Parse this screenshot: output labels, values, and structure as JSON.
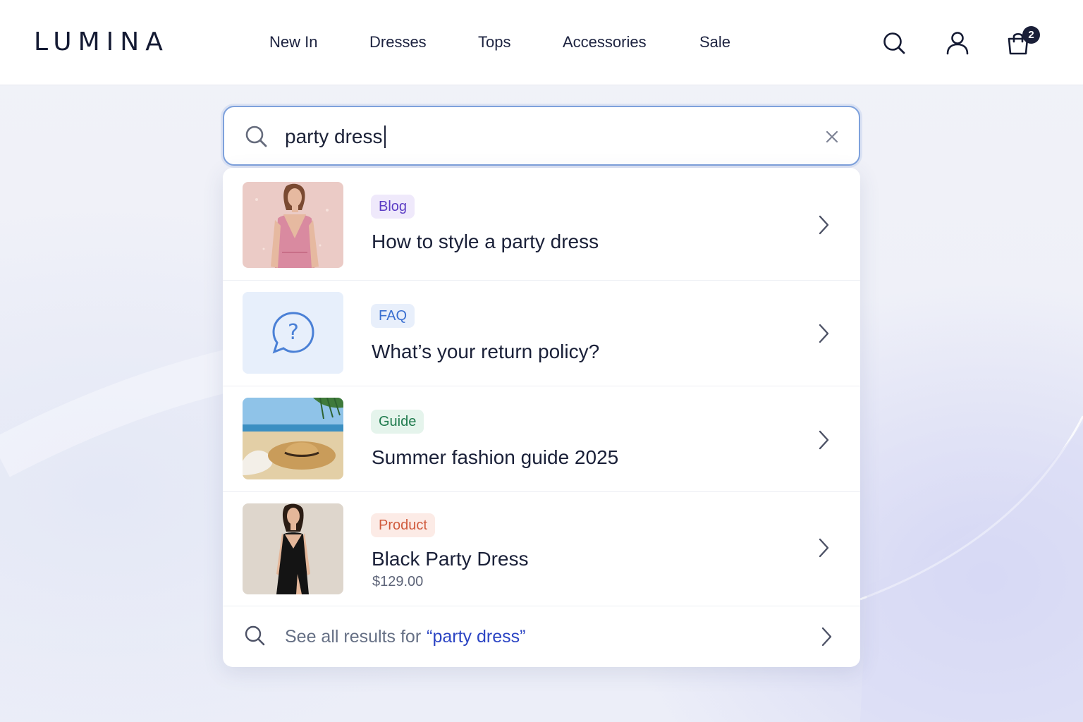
{
  "brand": {
    "logo": "LUMINA"
  },
  "nav": {
    "items": [
      "New In",
      "Dresses",
      "Tops",
      "Accessories",
      "Sale"
    ]
  },
  "header_icons": {
    "search": "search-icon",
    "account": "user-icon",
    "cart": "shopping-bag-icon",
    "cart_count": "2"
  },
  "search": {
    "value": "party dress",
    "icon": "search-icon",
    "clear_icon": "close-icon"
  },
  "results": [
    {
      "type": "Blog",
      "title": "How to style a party dress",
      "thumbnail": "pink-dress-photo"
    },
    {
      "type": "FAQ",
      "title": "What’s your return policy?",
      "thumbnail": "question-chat-icon"
    },
    {
      "type": "Guide",
      "title": "Summer fashion guide 2025",
      "thumbnail": "beach-hat-photo"
    },
    {
      "type": "Product",
      "title": "Black Party Dress",
      "price": "$129.00",
      "thumbnail": "black-dress-photo"
    }
  ],
  "see_all": {
    "prefix": "See all results for",
    "query": "“party dress”"
  },
  "colors": {
    "accent": "#2c45c4",
    "blog_badge_bg": "#efe9fb",
    "blog_badge_text": "#5b3cc4",
    "faq_badge_bg": "#e8effb",
    "faq_badge_text": "#3a6fd0",
    "guide_badge_bg": "#e5f4ec",
    "guide_badge_text": "#1f7a4d",
    "product_badge_bg": "#fcebe6",
    "product_badge_text": "#d05a3c"
  }
}
